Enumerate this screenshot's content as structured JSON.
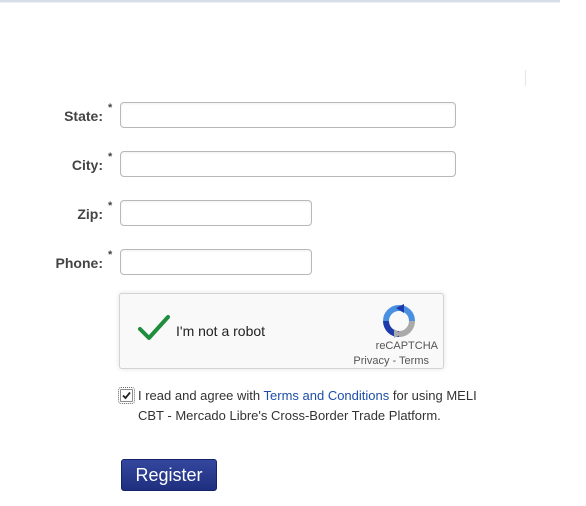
{
  "form": {
    "required_mark": "*",
    "state": {
      "label": "State:",
      "value": "",
      "placeholder": ""
    },
    "city": {
      "label": "City:",
      "value": "",
      "placeholder": ""
    },
    "zip": {
      "label": "Zip:",
      "value": "",
      "placeholder": ""
    },
    "phone": {
      "label": "Phone:",
      "value": "",
      "placeholder": ""
    }
  },
  "captcha": {
    "label": "I'm not a robot",
    "brand": "reCAPTCHA",
    "privacy": "Privacy",
    "separator": " - ",
    "terms": "Terms",
    "checked": true,
    "check_color": "#1e8e3e"
  },
  "agreement": {
    "checked": true,
    "text_before": "I read and agree with ",
    "link_text": "Terms and Conditions",
    "text_after": " for using MELI CBT - Mercado Libre's Cross-Border Trade Platform."
  },
  "register_button": {
    "label": "Register",
    "color": "#283a8f"
  }
}
